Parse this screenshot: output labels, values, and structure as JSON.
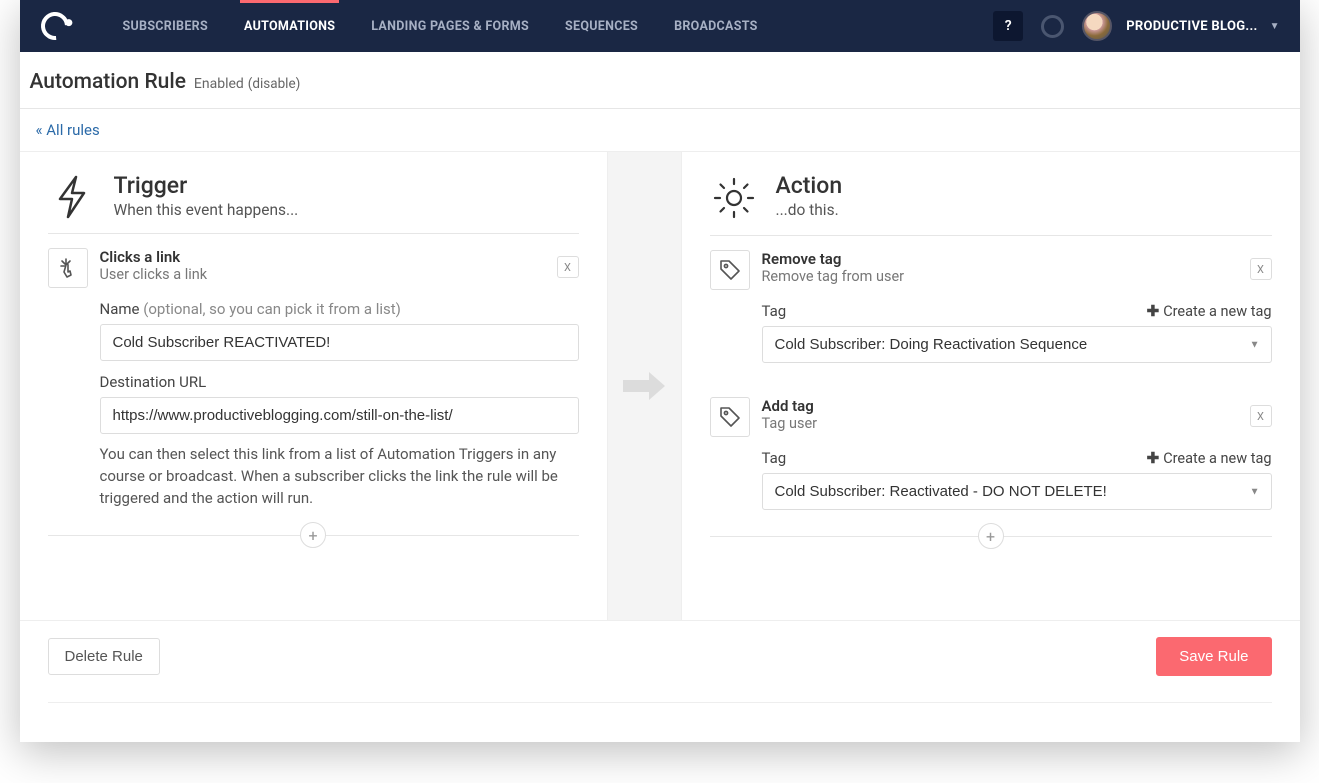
{
  "nav": {
    "items": [
      "SUBSCRIBERS",
      "AUTOMATIONS",
      "LANDING PAGES & FORMS",
      "SEQUENCES",
      "BROADCASTS"
    ],
    "active_index": 1
  },
  "header": {
    "help": "?",
    "user_name": "PRODUCTIVE BLOG..."
  },
  "title": {
    "heading": "Automation Rule",
    "status": "Enabled",
    "disable": "(disable)"
  },
  "breadcrumb": "« All rules",
  "trigger": {
    "title": "Trigger",
    "sub": "When this event happens...",
    "card": {
      "title": "Clicks a link",
      "sub": "User clicks a link",
      "close": "X",
      "name_label": "Name",
      "name_hint": "(optional, so you can pick it from a list)",
      "name_value": "Cold Subscriber REACTIVATED!",
      "url_label": "Destination URL",
      "url_value": "https://www.productiveblogging.com/still-on-the-list/",
      "help": "You can then select this link from a list of Automation Triggers in any course or broadcast. When a subscriber clicks the link the rule will be triggered and the action will run."
    }
  },
  "action": {
    "title": "Action",
    "sub": "...do this.",
    "create_link": "Create a new tag",
    "cards": [
      {
        "title": "Remove tag",
        "sub": "Remove tag from user",
        "close": "X",
        "tag_label": "Tag",
        "tag_value": "Cold Subscriber: Doing Reactivation Sequence"
      },
      {
        "title": "Add tag",
        "sub": "Tag user",
        "close": "X",
        "tag_label": "Tag",
        "tag_value": "Cold Subscriber: Reactivated - DO NOT DELETE!"
      }
    ]
  },
  "footer": {
    "delete": "Delete Rule",
    "save": "Save Rule"
  },
  "add_plus": "+"
}
